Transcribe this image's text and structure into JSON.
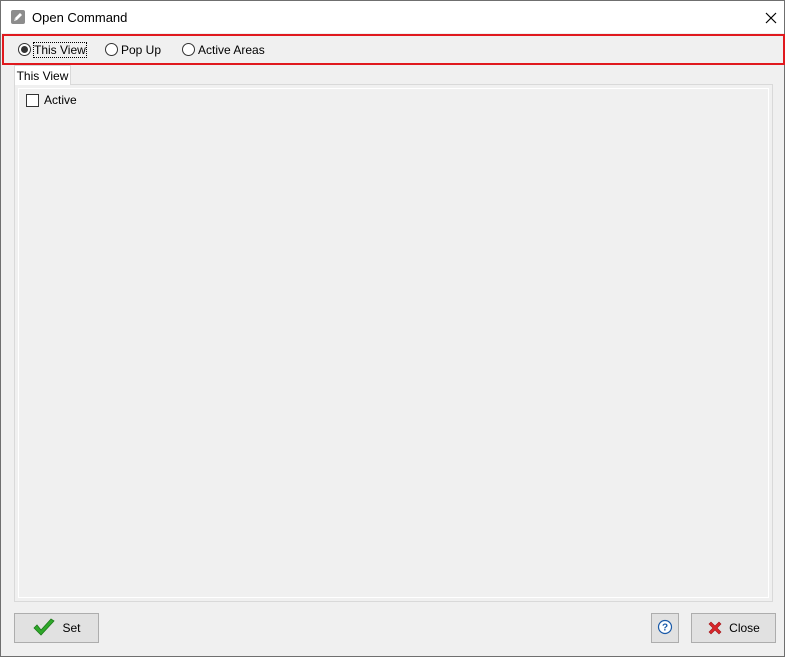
{
  "window": {
    "title": "Open Command"
  },
  "icons": {
    "app": "pencil-icon",
    "close": "close-icon",
    "set": "checkmark-icon",
    "help": "question-icon",
    "close_button": "red-x-icon"
  },
  "mode": {
    "options": [
      {
        "label": "This View",
        "selected": true
      },
      {
        "label": "Pop Up",
        "selected": false
      },
      {
        "label": "Active Areas",
        "selected": false
      }
    ]
  },
  "tabs": [
    {
      "label": "This View",
      "active": true
    }
  ],
  "panel": {
    "active_checkbox": {
      "label": "Active",
      "checked": false
    }
  },
  "buttons": {
    "set_label": "Set",
    "close_label": "Close"
  },
  "colors": {
    "highlight_border": "#e0191e",
    "checkmark": "#2fa82a",
    "close_x": "#d9262a",
    "help": "#1a5aa8"
  }
}
